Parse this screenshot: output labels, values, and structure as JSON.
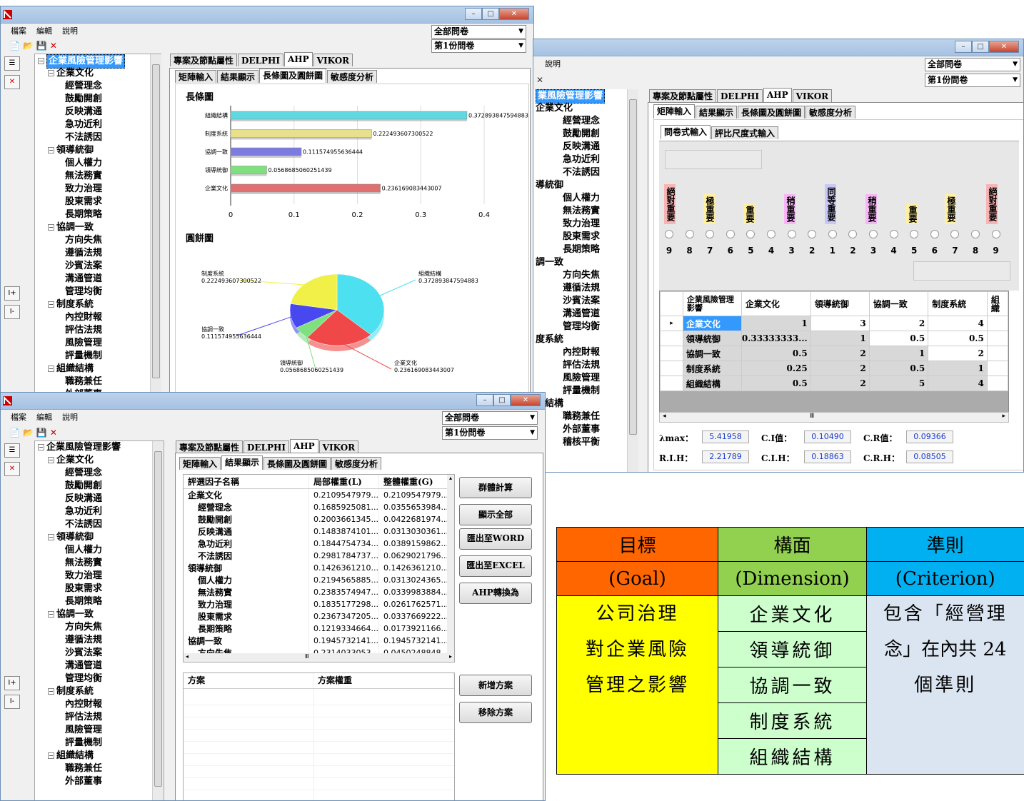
{
  "menu": {
    "file": "檔案",
    "edit": "編輯",
    "help": "說明"
  },
  "combo": {
    "all": "全部問卷",
    "first": "第1份問卷"
  },
  "side": {
    "add": "I+",
    "remove": "I-"
  },
  "tree": [
    {
      "t": "企業風險管理影響",
      "l": 0
    },
    {
      "t": "企業文化",
      "l": 1
    },
    {
      "t": "經營理念",
      "l": 2
    },
    {
      "t": "鼓勵開創",
      "l": 2
    },
    {
      "t": "反映溝通",
      "l": 2
    },
    {
      "t": "急功近利",
      "l": 2
    },
    {
      "t": "不法誘因",
      "l": 2
    },
    {
      "t": "領導統御",
      "l": 1
    },
    {
      "t": "個人權力",
      "l": 2
    },
    {
      "t": "無法務實",
      "l": 2
    },
    {
      "t": "致力治理",
      "l": 2
    },
    {
      "t": "股東需求",
      "l": 2
    },
    {
      "t": "長期策略",
      "l": 2
    },
    {
      "t": "協調一致",
      "l": 1
    },
    {
      "t": "方向失焦",
      "l": 2
    },
    {
      "t": "遵循法規",
      "l": 2
    },
    {
      "t": "沙賓法案",
      "l": 2
    },
    {
      "t": "溝通管道",
      "l": 2
    },
    {
      "t": "管理均衡",
      "l": 2
    },
    {
      "t": "制度系統",
      "l": 1
    },
    {
      "t": "內控財報",
      "l": 2
    },
    {
      "t": "評估法規",
      "l": 2
    },
    {
      "t": "風險管理",
      "l": 2
    },
    {
      "t": "評量機制",
      "l": 2
    },
    {
      "t": "組織結構",
      "l": 1
    },
    {
      "t": "職務兼任",
      "l": 2
    },
    {
      "t": "外部董事",
      "l": 2
    }
  ],
  "tree2": [
    {
      "t": "業風險管理影響",
      "l": 0
    },
    {
      "t": "企業文化",
      "l": 0
    },
    {
      "t": "經營理念",
      "l": 2
    },
    {
      "t": "鼓勵開創",
      "l": 2
    },
    {
      "t": "反映溝通",
      "l": 2
    },
    {
      "t": "急功近利",
      "l": 2
    },
    {
      "t": "不法誘因",
      "l": 2
    },
    {
      "t": "導統御",
      "l": 0
    },
    {
      "t": "個人權力",
      "l": 2
    },
    {
      "t": "無法務實",
      "l": 2
    },
    {
      "t": "致力治理",
      "l": 2
    },
    {
      "t": "股東需求",
      "l": 2
    },
    {
      "t": "長期策略",
      "l": 2
    },
    {
      "t": "調一致",
      "l": 0
    },
    {
      "t": "方向失焦",
      "l": 2
    },
    {
      "t": "遵循法規",
      "l": 2
    },
    {
      "t": "沙賓法案",
      "l": 2
    },
    {
      "t": "溝通管道",
      "l": 2
    },
    {
      "t": "管理均衡",
      "l": 2
    },
    {
      "t": "度系統",
      "l": 0
    },
    {
      "t": "內控財報",
      "l": 2
    },
    {
      "t": "評估法規",
      "l": 2
    },
    {
      "t": "風險管理",
      "l": 2
    },
    {
      "t": "評量機制",
      "l": 2
    },
    {
      "t": "織結構",
      "l": 0
    },
    {
      "t": "職務兼任",
      "l": 2
    },
    {
      "t": "外部董事",
      "l": 2
    },
    {
      "t": "稽核平衡",
      "l": 2
    }
  ],
  "tabs_main": [
    "專案及節點屬性",
    "DELPHI",
    "AHP",
    "VIKOR"
  ],
  "tabs_sub": [
    "矩陣輸入",
    "結果顯示",
    "長條圖及圓餅圖",
    "敏感度分析"
  ],
  "tabs_input": [
    "問卷式輸入",
    "評比尺度式輸入"
  ],
  "chart_data": [
    {
      "type": "bar",
      "title": "長條圖",
      "categories": [
        "組織結構",
        "制度系統",
        "協調一致",
        "領導統御",
        "企業文化"
      ],
      "values": [
        0.372893847594883,
        0.222493607300522,
        0.111574955636444,
        0.0568685060251439,
        0.236169083443007
      ],
      "labels": [
        "0.372893847594883",
        "0.222493607300522",
        "0.111574955636444",
        "0.0568685060251439",
        "0.236169083443007"
      ],
      "colors": [
        "#5fd8e0",
        "#e8e08a",
        "#7b7be0",
        "#7fe07f",
        "#e07070"
      ],
      "xlim": [
        0,
        0.4
      ],
      "xticks": [
        "0",
        "0.1",
        "0.2",
        "0.3",
        "0.4"
      ]
    },
    {
      "type": "pie",
      "title": "圓餅圖",
      "categories": [
        "組織結構",
        "企業文化",
        "領導統御",
        "協調一致",
        "制度系統"
      ],
      "values": [
        0.372893847594883,
        0.236169083443007,
        0.0568685060251439,
        0.111574955636444,
        0.222493607300522
      ],
      "labels": [
        "0.372893847594883",
        "0.236169083443007",
        "0.0568685060251439",
        "0.111574955636444",
        "0.222493607300522"
      ],
      "colors": [
        "#4de0f0",
        "#f04848",
        "#7fe07f",
        "#4848f0",
        "#f0f048"
      ]
    }
  ],
  "scale": {
    "labels": [
      "絕對重要",
      "極重要",
      "重要",
      "稍重要",
      "同等重要",
      "稍重要",
      "重要",
      "極重要",
      "絕對重要"
    ],
    "colors": [
      "#f8b4b4",
      "#fff0a0",
      "#fff0a0",
      "#f8b4f8",
      "#c8c8f8",
      "#f8b4f8",
      "#fff0a0",
      "#fff0a0",
      "#f8b4b4"
    ],
    "numbers": [
      "9",
      "8",
      "7",
      "6",
      "5",
      "4",
      "3",
      "2",
      "1",
      "2",
      "3",
      "4",
      "5",
      "6",
      "7",
      "8",
      "9"
    ]
  },
  "matrix": {
    "headers": [
      "企業風險管理影響",
      "企業文化",
      "領導統御",
      "協調一致",
      "制度系統",
      "組織"
    ],
    "rows": [
      [
        "企業文化",
        "1",
        "3",
        "2",
        "4"
      ],
      [
        "領導統御",
        "0.33333333...",
        "1",
        "0.5",
        "0.5"
      ],
      [
        "協調一致",
        "0.5",
        "2",
        "1",
        "2"
      ],
      [
        "制度系統",
        "0.25",
        "2",
        "0.5",
        "1"
      ],
      [
        "組織結構",
        "0.5",
        "2",
        "5",
        "4"
      ]
    ]
  },
  "stats": {
    "lmax_l": "λmax：",
    "lmax": "5.41958",
    "ci_l": "C.I值：",
    "ci": "0.10490",
    "cr_l": "C.R值：",
    "cr": "0.09366",
    "ri_l": "R.I.H：",
    "ri": "2.21789",
    "cih_l": "C.I.H：",
    "cih": "0.18863",
    "crh_l": "C.R.H：",
    "crh": "0.08505"
  },
  "results": {
    "headers": [
      "評選因子名稱",
      "局部權重(L)",
      "整體權重(G)"
    ],
    "rows": [
      [
        "企業文化",
        "0.2109547979...",
        "0.2109547979...",
        0
      ],
      [
        "經營理念",
        "0.1685925081...",
        "0.0355653984...",
        1
      ],
      [
        "鼓勵開創",
        "0.2003661345...",
        "0.0422681974...",
        1
      ],
      [
        "反映溝通",
        "0.1483874101...",
        "0.0313030361...",
        1
      ],
      [
        "急功近利",
        "0.1844754734...",
        "0.0389159862...",
        1
      ],
      [
        "不法誘因",
        "0.2981784737...",
        "0.0629021796...",
        1
      ],
      [
        "領導統御",
        "0.1426361210...",
        "0.1426361210...",
        0
      ],
      [
        "個人權力",
        "0.2194565885...",
        "0.0313024365...",
        1
      ],
      [
        "無法務實",
        "0.2383574947...",
        "0.0339983884...",
        1
      ],
      [
        "致力治理",
        "0.1835177298...",
        "0.0261762571...",
        1
      ],
      [
        "股東需求",
        "0.2367347205...",
        "0.0337669222...",
        1
      ],
      [
        "長期策略",
        "0.1219334664...",
        "0.0173921166...",
        1
      ],
      [
        "協調一致",
        "0.1945732141...",
        "0.1945732141...",
        0
      ],
      [
        "方向失焦",
        "0.2314033053...",
        "0.0450248848...",
        1
      ]
    ]
  },
  "plans": {
    "headers": [
      "方案",
      "方案權重"
    ]
  },
  "buttons": [
    "群體計算",
    "顯示全部",
    "匯出至WORD",
    "匯出至EXCEL",
    "AHP轉換為",
    "新增方案",
    "移除方案"
  ],
  "ref_table": {
    "h1": [
      "目標",
      "構面",
      "準則"
    ],
    "h2": [
      "(Goal)",
      "(Dimension)",
      "(Criterion)"
    ],
    "goal": [
      "公司治理",
      "對企業風險",
      "管理之影響"
    ],
    "dims": [
      "企業文化",
      "領導統御",
      "協調一致",
      "制度系統",
      "組織結構"
    ],
    "crit": [
      "包含「經營理",
      "念」在內共 24",
      "個準則"
    ]
  }
}
